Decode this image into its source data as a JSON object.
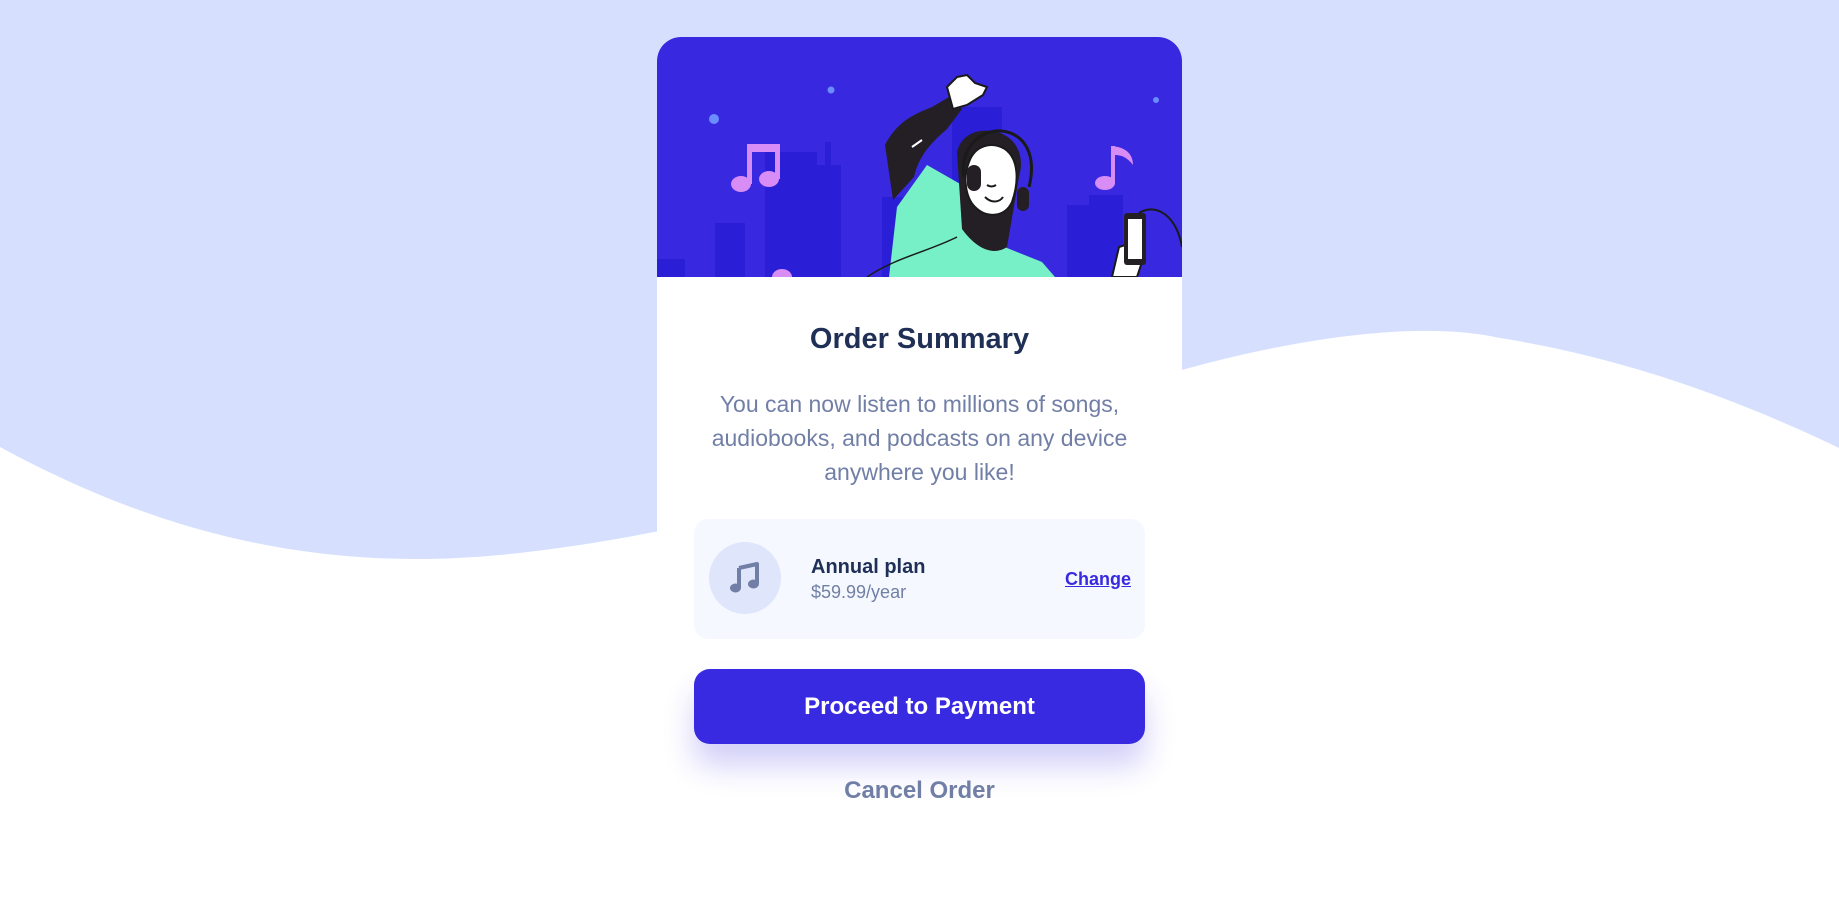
{
  "page": {
    "background_color": "#d6e0fe",
    "wave_color": "#ffffff"
  },
  "card": {
    "title": "Order Summary",
    "description": "You can now listen to millions of songs, audiobooks, and podcasts on any device anywhere you like!",
    "hero_icon": "illustration-dancing-person-with-headphones"
  },
  "plan": {
    "icon": "music-note-icon",
    "name": "Annual plan",
    "price": "$59.99/year",
    "change_label": "Change"
  },
  "actions": {
    "proceed_label": "Proceed to Payment",
    "cancel_label": "Cancel Order"
  },
  "colors": {
    "primary": "#382ae1",
    "dark_text": "#1f2f56",
    "muted_text": "#717fa6",
    "plan_bg": "#f5f8ff"
  }
}
